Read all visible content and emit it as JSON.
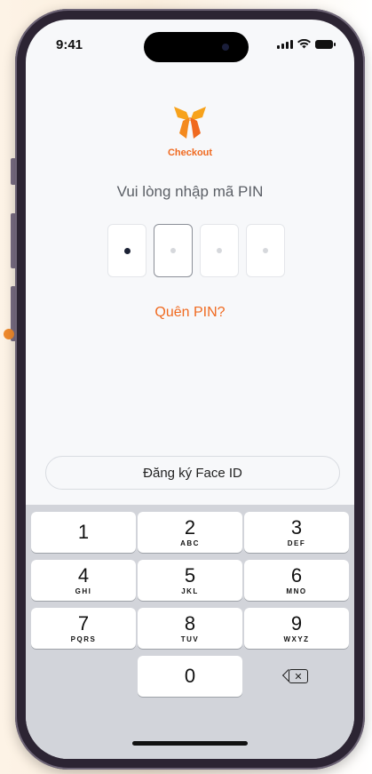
{
  "status_bar": {
    "time": "9:41",
    "signal_icon": "cellular-signal-icon",
    "wifi_icon": "wifi-icon",
    "battery_icon": "battery-icon"
  },
  "brand": {
    "name": "Checkout",
    "logo_icon": "checkout-logo-icon",
    "color": "#f06a20"
  },
  "prompt": "Vui lòng nhập mã PIN",
  "pin": {
    "length": 4,
    "entered": 1
  },
  "forgot_pin": "Quên PIN?",
  "face_id_button": "Đăng ký Face ID",
  "keypad": {
    "keys": [
      {
        "num": "1",
        "letters": ""
      },
      {
        "num": "2",
        "letters": "ABC"
      },
      {
        "num": "3",
        "letters": "DEF"
      },
      {
        "num": "4",
        "letters": "GHI"
      },
      {
        "num": "5",
        "letters": "JKL"
      },
      {
        "num": "6",
        "letters": "MNO"
      },
      {
        "num": "7",
        "letters": "PQRS"
      },
      {
        "num": "8",
        "letters": "TUV"
      },
      {
        "num": "9",
        "letters": "WXYZ"
      },
      {
        "num": "0",
        "letters": ""
      }
    ],
    "delete_icon": "backspace-icon"
  }
}
